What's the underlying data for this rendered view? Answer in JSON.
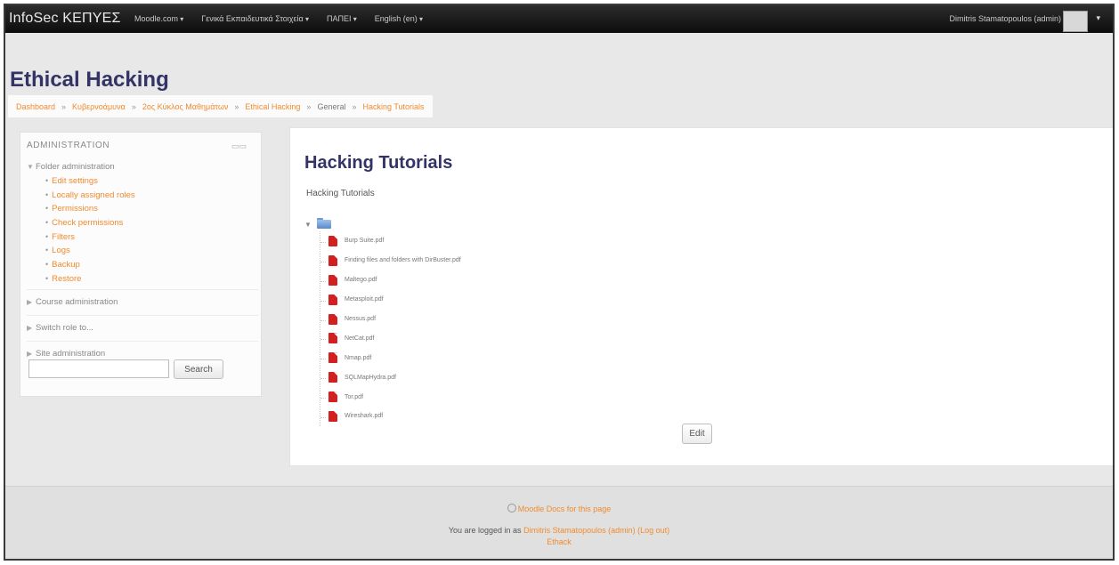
{
  "navbar": {
    "brand": "InfoSec ΚΕΠΥΕΣ",
    "menus": [
      "Moodle.com",
      "Γενικά Εκπαιδευτικά Στοιχεία",
      "ΠΑΠΕΙ",
      "English (en)"
    ],
    "user_name": "Dimitris Stamatopoulos (admin)"
  },
  "page_title": "Ethical Hacking",
  "breadcrumb": {
    "items": [
      "Dashboard",
      "Κυβερνοάμυνα",
      "2ος Κύκλος Μαθημάτων",
      "Ethical Hacking",
      "General",
      "Hacking Tutorials"
    ],
    "separator": "»"
  },
  "admin": {
    "title": "ADMINISTRATION",
    "folder_admin": "Folder administration",
    "folder_links": [
      "Edit settings",
      "Locally assigned roles",
      "Permissions",
      "Check permissions",
      "Filters",
      "Logs",
      "Backup",
      "Restore"
    ],
    "course_admin": "Course administration",
    "switch_role": "Switch role to...",
    "site_admin": "Site administration",
    "search_button": "Search",
    "search_value": ""
  },
  "main": {
    "title": "Hacking Tutorials",
    "intro": "Hacking Tutorials",
    "files": [
      "Burp Suite.pdf",
      "Finding files and folders with DirBuster.pdf",
      "Maltego.pdf",
      "Metasploit.pdf",
      "Nessus.pdf",
      "NetCat.pdf",
      "Nmap.pdf",
      "SQLMapHydra.pdf",
      "Tor.pdf",
      "Wireshark.pdf"
    ],
    "edit_button": "Edit"
  },
  "footer": {
    "docs_link": "Moodle Docs for this page",
    "logged_prefix": "You are logged in as",
    "logged_user": "Dimitris Stamatopoulos (admin)",
    "logout": "(Log out)",
    "home": "Ethack"
  },
  "colors": {
    "accent_link": "#f08b2e",
    "heading": "#333366",
    "navbar": "#1a1a1a",
    "pdf": "#d21f1f"
  }
}
